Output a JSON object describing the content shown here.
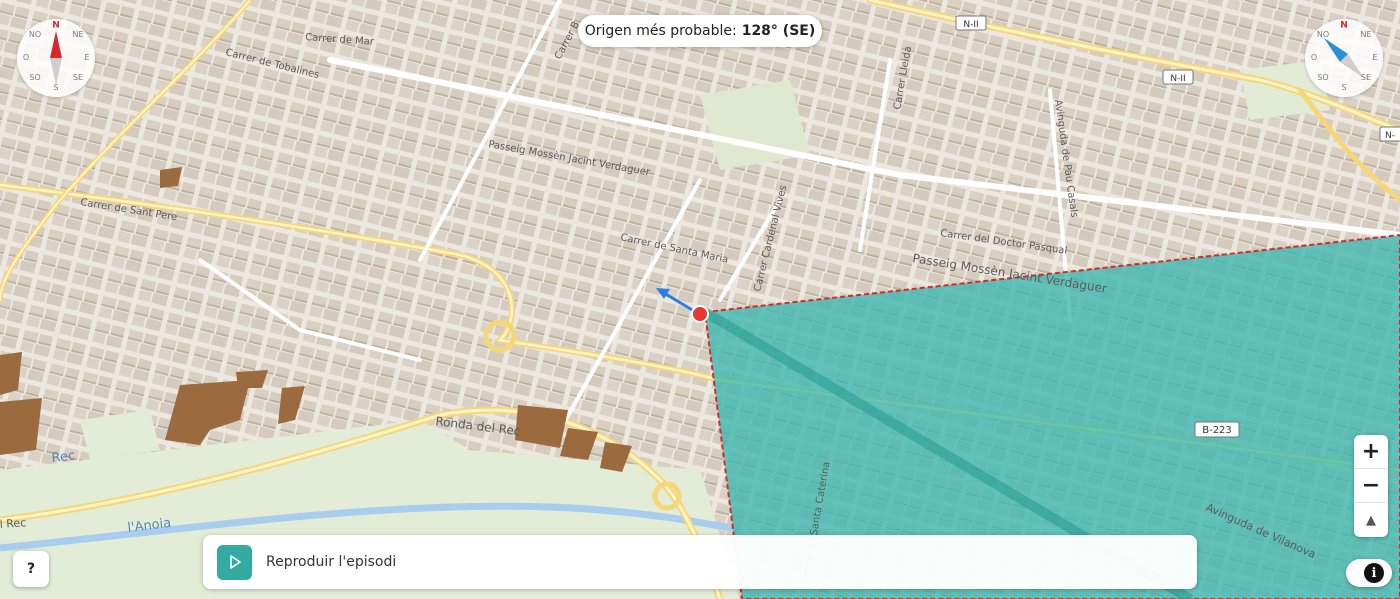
{
  "heading": {
    "label": "Origen més probable:",
    "value": "128° (SE)"
  },
  "compass": {
    "n": "N",
    "ne": "NE",
    "e": "E",
    "se": "SE",
    "s": "S",
    "so": "SO",
    "o": "O",
    "no": "NO"
  },
  "compass_right": {
    "heading_deg": 128
  },
  "roads": {
    "n2_a": "N-II",
    "n2_b": "N-II",
    "n2_c": "N-",
    "b223": "B-223",
    "ronda_rec": "Ronda del Rec",
    "anoia": "l'Anoia",
    "rec_left": "Rec",
    "rec_bottom": "l Rec",
    "passeig_mossen_top": "Passeig Mossèn Jacint Verdaguer",
    "passeig_mossen_mid": "Passeig Mossèn Jacint Verdaguer",
    "cardenal_vives": "Carrer Cardenal Vives",
    "carrer_lleida": "Carrer Lleida",
    "avinguda_pau_casals": "Avinguda de Pau Casals",
    "dr_pasqual": "Carrer del Doctor Pasqual",
    "santa_caterina": "Carrer de Santa Caterina",
    "santa_maria": "Carrer de Santa Maria",
    "carrer_b": "Carrer B",
    "carrer_tobalines": "Carrer de Tobalines",
    "avinguda_vilanova": "Avinguda de Vilanova",
    "carrer_sant_pere": "Carrer de Sant Pere",
    "carrer_mar": "Carrer de Mar"
  },
  "controls": {
    "zoom_in": "+",
    "zoom_out": "−",
    "reset_north": "▲",
    "help": "?",
    "info": "i"
  },
  "player": {
    "label": "Reproduir l'episodi"
  },
  "colors": {
    "sector_fill": "#3bb7b0",
    "sector_border": "#d8282b",
    "origin": "#e53935",
    "arrow": "#2c7fe0",
    "play": "#33aaa2"
  }
}
